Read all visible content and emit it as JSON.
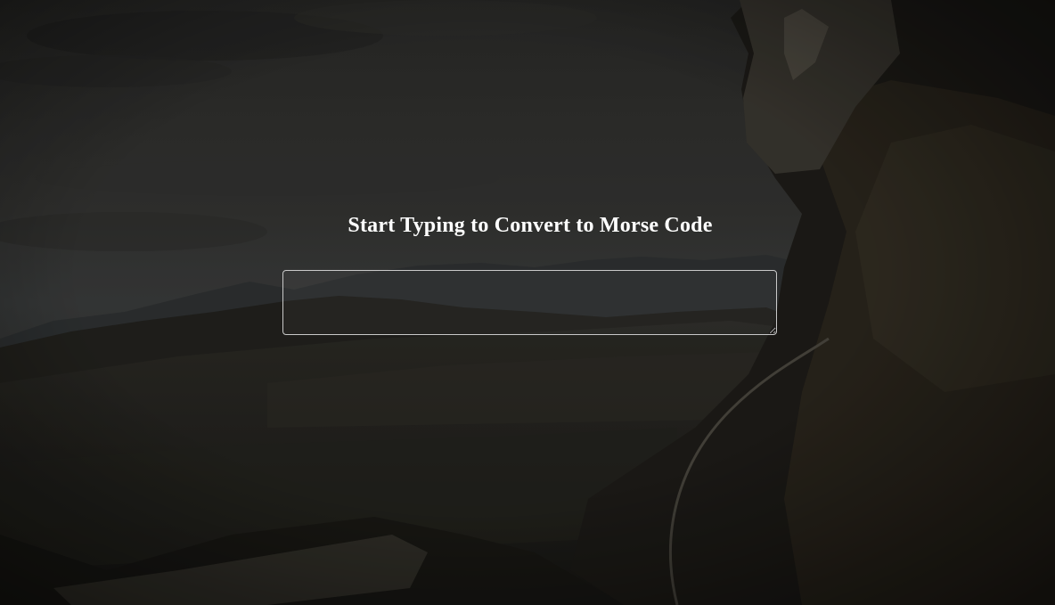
{
  "page": {
    "heading": "Start Typing to Convert to Morse Code"
  },
  "input": {
    "value": "",
    "placeholder": ""
  },
  "background": {
    "icon": "soldier-helicopter-mountain-photo"
  }
}
